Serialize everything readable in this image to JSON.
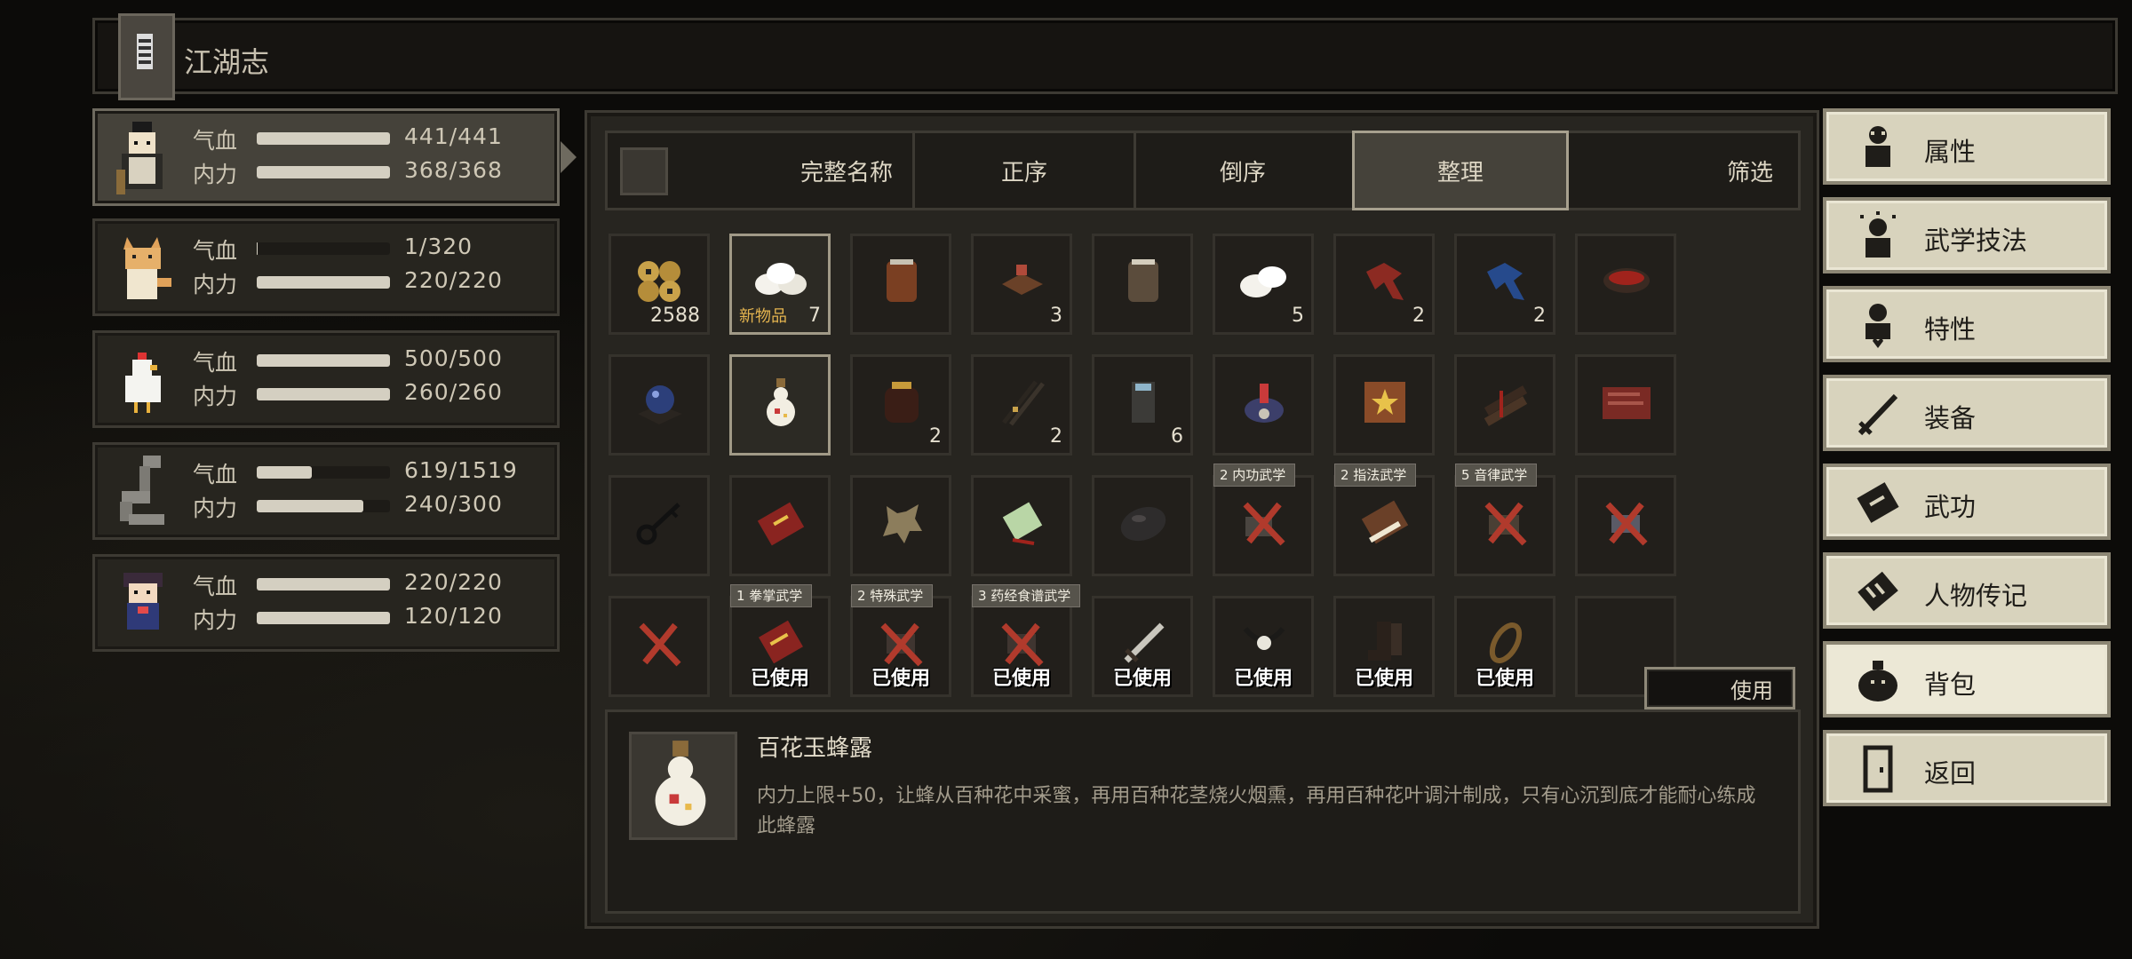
{
  "header": {
    "title": "江湖志"
  },
  "party": [
    {
      "hp_label": "气血",
      "hp_value": "441/441",
      "hp_ratio": 1.0,
      "mp_label": "内力",
      "mp_value": "368/368",
      "mp_ratio": 1.0
    },
    {
      "hp_label": "气血",
      "hp_value": "1/320",
      "hp_ratio": 0.003,
      "mp_label": "内力",
      "mp_value": "220/220",
      "mp_ratio": 1.0
    },
    {
      "hp_label": "气血",
      "hp_value": "500/500",
      "hp_ratio": 1.0,
      "mp_label": "内力",
      "mp_value": "260/260",
      "mp_ratio": 1.0
    },
    {
      "hp_label": "气血",
      "hp_value": "619/1519",
      "hp_ratio": 0.41,
      "mp_label": "内力",
      "mp_value": "240/300",
      "mp_ratio": 0.8
    },
    {
      "hp_label": "气血",
      "hp_value": "220/220",
      "hp_ratio": 1.0,
      "mp_label": "内力",
      "mp_value": "120/120",
      "mp_ratio": 1.0
    }
  ],
  "sortbar": {
    "full_name": "完整名称",
    "ascending": "正序",
    "descending": "倒序",
    "organize": "整理",
    "filter": "筛选"
  },
  "inventory": {
    "row1": [
      {
        "icon": "copper-coins-icon",
        "count": "2588"
      },
      {
        "icon": "steamed-buns-icon",
        "count": "7",
        "tag": "新物品"
      },
      {
        "icon": "wine-jar-icon"
      },
      {
        "icon": "food-box-icon",
        "count": "3"
      },
      {
        "icon": "grey-jar-icon"
      },
      {
        "icon": "buns-icon",
        "count": "5"
      },
      {
        "icon": "red-claw-icon",
        "count": "2"
      },
      {
        "icon": "blue-claw-icon",
        "count": "2"
      },
      {
        "icon": "red-bowl-icon"
      }
    ],
    "row2": [
      {
        "icon": "blue-orb-icon"
      },
      {
        "icon": "honey-gourd-icon"
      },
      {
        "icon": "red-pot-icon",
        "count": "2"
      },
      {
        "icon": "chopsticks-icon",
        "count": "2"
      },
      {
        "icon": "tin-can-icon",
        "count": "6"
      },
      {
        "icon": "rooster-incense-icon"
      },
      {
        "icon": "star-scroll-icon"
      },
      {
        "icon": "wood-bundle-icon"
      },
      {
        "icon": "red-map-icon"
      }
    ],
    "row3": [
      {
        "icon": "key-icon"
      },
      {
        "icon": "red-scroll-icon"
      },
      {
        "icon": "animal-hide-icon"
      },
      {
        "icon": "jade-token-icon"
      },
      {
        "icon": "stone-icon"
      },
      {
        "icon": "crossed-manual-icon",
        "banner": "2 内功武学"
      },
      {
        "icon": "manual-book-icon",
        "banner": "2 指法武学"
      },
      {
        "icon": "crossed-manual-icon",
        "banner": "5 音律武学"
      },
      {
        "icon": "crossed-manual-icon"
      }
    ],
    "row4": [
      {
        "icon": "crossed-manual-icon"
      },
      {
        "icon": "red-book-icon",
        "banner": "1 拳掌武学",
        "used": "已使用"
      },
      {
        "icon": "crossed-manual-icon",
        "banner": "2 特殊武学",
        "used": "已使用"
      },
      {
        "icon": "crossed-manual-icon",
        "banner": "3 药经食谱武学",
        "used": "已使用"
      },
      {
        "icon": "sword-icon",
        "used": "已使用"
      },
      {
        "icon": "necklace-icon",
        "used": "已使用"
      },
      {
        "icon": "boots-icon",
        "used": "已使用"
      },
      {
        "icon": "bracelet-icon",
        "used": "已使用"
      },
      {
        "icon": "empty-slot"
      }
    ]
  },
  "use_button": "使用",
  "selected_item": {
    "name": "百花玉蜂露",
    "description": "内力上限+50，让蜂从百种花中采蜜，再用百种花茎烧火烟熏，再用百种花叶调汁制成，只有心沉到底才能耐心练成此蜂露"
  },
  "menu": [
    {
      "label": "属性",
      "icon": "figure-icon"
    },
    {
      "label": "武学技法",
      "icon": "figure-aura-icon"
    },
    {
      "label": "特性",
      "icon": "figure-heart-icon"
    },
    {
      "label": "装备",
      "icon": "sword-icon"
    },
    {
      "label": "武功",
      "icon": "book-icon"
    },
    {
      "label": "人物传记",
      "icon": "scroll-icon"
    },
    {
      "label": "背包",
      "icon": "bag-icon"
    },
    {
      "label": "返回",
      "icon": "door-icon"
    }
  ],
  "colors": {
    "panel": "#272520",
    "border": "#3d3a33",
    "menu_bg": "#d8d3bd",
    "accent_gold": "#e4b44f",
    "used_red": "#b13a2c"
  }
}
